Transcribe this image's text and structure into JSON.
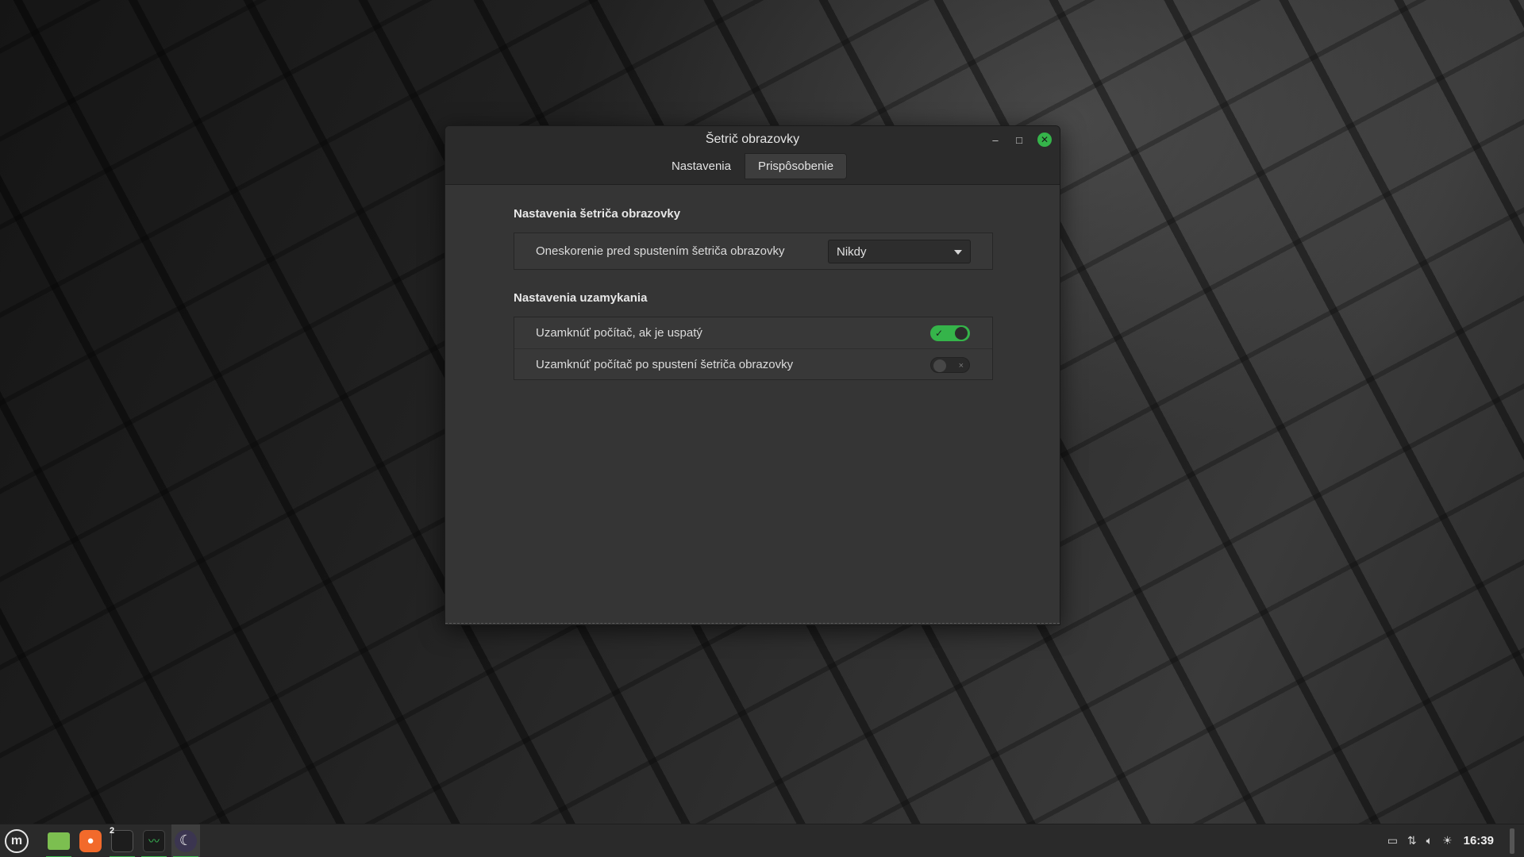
{
  "window": {
    "title": "Šetrič obrazovky",
    "tabs": [
      {
        "label": "Nastavenia",
        "active": false
      },
      {
        "label": "Prispôsobenie",
        "active": true
      }
    ],
    "controls": {
      "minimize": "–",
      "maximize": "□",
      "close": "✕"
    }
  },
  "screensaver_section": {
    "title": "Nastavenia šetriča obrazovky",
    "delay_label": "Oneskorenie pred spustením šetriča obrazovky",
    "delay_value": "Nikdy"
  },
  "lock_section": {
    "title": "Nastavenia uzamykania",
    "rows": [
      {
        "label": "Uzamknúť počítač, ak je uspatý",
        "enabled": true
      },
      {
        "label": "Uzamknúť počítač po spustení šetriča obrazovky",
        "enabled": false
      }
    ]
  },
  "toggle_marks": {
    "on": "✓",
    "off": "×"
  },
  "taskbar": {
    "menu_icon": "linux-mint-logo",
    "launchers": [
      {
        "name": "files-icon",
        "running": true
      },
      {
        "name": "firefox-icon",
        "running": false
      },
      {
        "name": "terminal-icon",
        "running": true,
        "badge": "2"
      },
      {
        "name": "system-monitor-icon",
        "running": true
      },
      {
        "name": "screensaver-icon",
        "running": true,
        "active": true
      }
    ],
    "tray_icons": [
      "display-icon",
      "network-icon",
      "volume-icon",
      "brightness-icon"
    ],
    "clock": "16:39"
  },
  "colors": {
    "accent": "#35b44a",
    "window_bg": "#353535",
    "titlebar_bg": "#2b2b2b",
    "panel_bg": "#2a2a2a"
  }
}
